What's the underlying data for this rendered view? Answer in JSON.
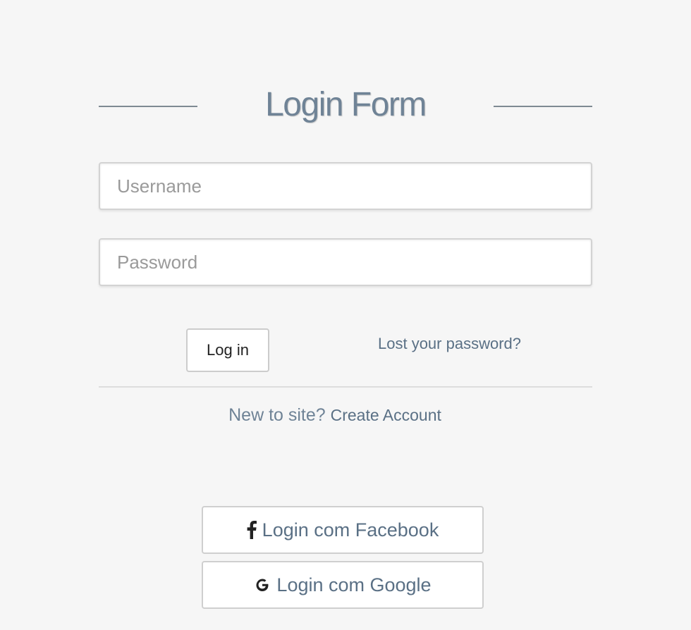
{
  "form": {
    "title": "Login Form",
    "username_placeholder": "Username",
    "password_placeholder": "Password",
    "login_button": "Log in",
    "lost_password_link": "Lost your password?",
    "new_to_site_text": "New to site?",
    "create_account_link": "Create Account"
  },
  "social": {
    "facebook_label": "Login com Facebook",
    "google_label": "Login com Google",
    "facebook_icon": "facebook-icon",
    "google_icon": "google-icon"
  },
  "colors": {
    "background": "#f6f6f6",
    "title": "#6f8396",
    "link": "#5a7085",
    "border": "#d3d3d3"
  }
}
